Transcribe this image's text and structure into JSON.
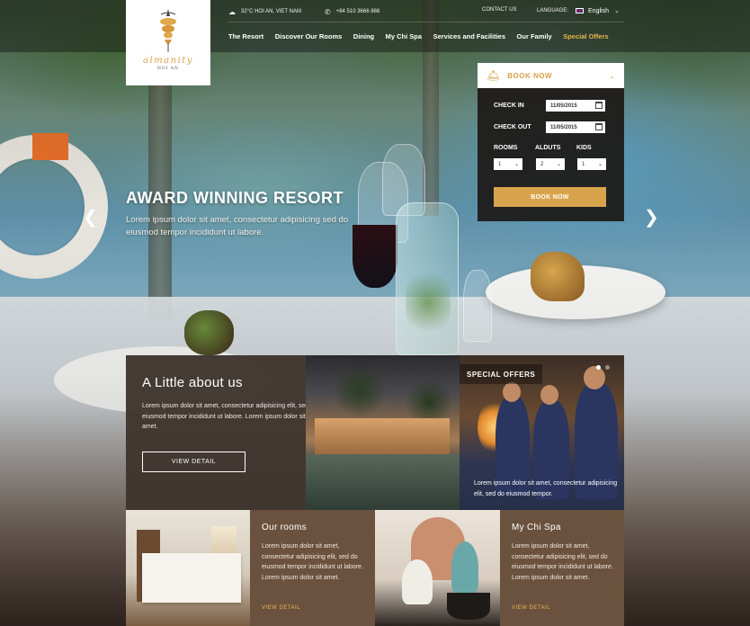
{
  "header": {
    "weather": "32°C  HOI AN, VIET NAM",
    "phone": "+84 510 3666 888",
    "contact_label": "CONTACT US",
    "language_label": "LANGUAGE:",
    "language_value": "English",
    "nav": [
      {
        "label": "The Resort"
      },
      {
        "label": "Discover Our Rooms"
      },
      {
        "label": "Dining"
      },
      {
        "label": "My Chi Spa"
      },
      {
        "label": "Services and Facilities"
      },
      {
        "label": "Our Family"
      },
      {
        "label": "Special Offers",
        "active": true
      }
    ]
  },
  "logo": {
    "name": "almanity",
    "sub": "HOI AN"
  },
  "slider": {
    "title": "AWARD WINNING RESORT",
    "text": "Lorem ipsum dolor sit amet, consectetur adipisicing sed do eiusmod tempor incididunt ut labore."
  },
  "booking": {
    "header": "BOOK NOW",
    "check_in_label": "CHECK IN",
    "check_in_value": "11/05/2015",
    "check_out_label": "CHECK OUT",
    "check_out_value": "11/05/2015",
    "rooms_label": "ROOMS",
    "rooms_value": "1",
    "adults_label": "ALDUTS",
    "adults_value": "2",
    "kids_label": "KIDS",
    "kids_value": "1",
    "button": "BOOK NOW"
  },
  "about": {
    "title": "A Little about us",
    "text": "Lorem ipsum dolor sit amet, consectetur adipisicing elit, sed do eiusmod tempor incididunt ut labore. Lorem ipsum dolor sit amet.",
    "button": "VIEW DETAIL"
  },
  "offers": {
    "tag": "SPECIAL OFFERS",
    "caption": "Lorem ipsum dolor sit amet, consectetur adipisicing elit, sed do eiusmod tempor."
  },
  "rooms": {
    "title": "Our rooms",
    "text": "Lorem ipsum dolor sit amet, consectetur adipisicing elit, sed do eiusmod tempor incididunt ut labore. Lorem ipsum dolor sit amet.",
    "link": "VIEW DETAIL"
  },
  "spa": {
    "title": "My Chi Spa",
    "text": "Lorem ipsum dolor sit amet, consectetur adipisicing elit, sed do eiusmod tempor incididunt ut labore. Lorem ipsum dolor sit amet.",
    "link": "VIEW DETAIL"
  },
  "colors": {
    "accent": "#d8a44b",
    "active_nav": "#e9b54f",
    "panel": "#6b523e"
  },
  "icons": [
    "weather-icon",
    "phone-icon",
    "flag-icon",
    "bell-icon",
    "calendar-icon",
    "chevron-down-icon",
    "arrow-left-icon",
    "arrow-right-icon"
  ]
}
